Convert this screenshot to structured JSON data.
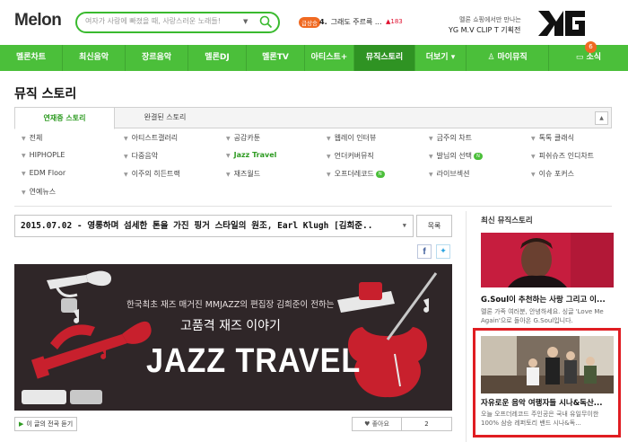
{
  "header": {
    "logo": "Melon",
    "search_placeholder": "여자가 사랑에 빠졌을 때, 사랑스러운 노래들!",
    "chart_badge": "급상승",
    "chart_rank": "4.",
    "chart_song": "그래도 주르륵 ...",
    "chart_change": "183",
    "ad_line1": "멜론 쇼핑에서만 만나는",
    "ad_line2": "YG M.V CLIP T 기획전",
    "ad_logo": "YG"
  },
  "nav": {
    "items": [
      "멜론차트",
      "최신음악",
      "장르음악",
      "멜론DJ",
      "멜론TV",
      "아티스트+",
      "뮤직스토리",
      "더보기 ▾",
      "마이뮤직",
      "소식"
    ],
    "active": "뮤직스토리",
    "notice_count": "6"
  },
  "page": {
    "title": "뮤직 스토리"
  },
  "tabs": [
    "연재중 스토리",
    "완결된 스토리"
  ],
  "categories": [
    [
      "전체",
      "아티스트갤러리",
      "공감카툰",
      "웹레이 인터뷰",
      "금주의 차트",
      "톡톡 클래식"
    ],
    [
      "HIPHOPLE",
      "다중음악",
      "Jazz Travel",
      "언더커버뮤직",
      "발님의 선택",
      "피쉬슈즈 인디차트"
    ],
    [
      "EDM Floor",
      "이주의 히든트랙",
      "재즈월드",
      "오프더레코드",
      "라이브섹션",
      "이슈 포커스"
    ],
    [
      "연예뉴스"
    ]
  ],
  "new_badge": "N",
  "article": {
    "select": "2015.07.02 - 영롱하며 섬세한 톤을 가진 핑거 스타일의 원조, Earl Klugh [김희준..",
    "list_button": "목록",
    "banner_line1": "한국최초 재즈 매거진 MMJAZZ의 편집장 김희준이 전하는",
    "banner_line2": "고품격 재즈 이야기",
    "banner_title": "JAZZ TRAVEL",
    "listen_label": "이 글의 전곡 듣기",
    "like_label": "좋아요",
    "like_count": "2"
  },
  "sidebar": {
    "title": "최신 뮤직스토리",
    "items": [
      {
        "title": "G.Soul이 추천하는 사랑 그리고 이...",
        "desc": "멜론 가족 여러분, 안녕하세요. 싱글 'Love Me Again'으로 돌아온 G.Soul입니다."
      },
      {
        "title": "자유로운 음악 여행자들 시나&독산...",
        "desc": "오늘 오프더레코드 주인공은 국내 유일무이한 100% 삼승 레퍼토리 밴드 시나&독..."
      }
    ]
  },
  "colors": {
    "brand": "#4bbf3a",
    "highlight": "#e01d22"
  }
}
